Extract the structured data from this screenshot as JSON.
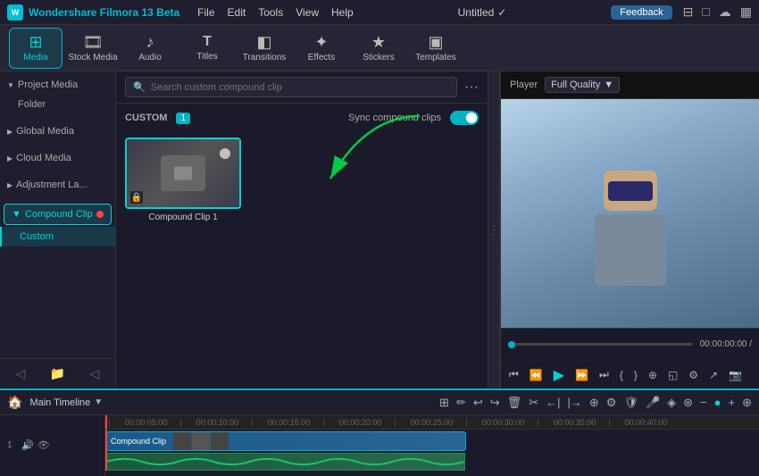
{
  "app": {
    "name": "Wondershare Filmora 13 Beta",
    "title": "Untitled",
    "feedback_label": "Feedback"
  },
  "topbar": {
    "menu": [
      "File",
      "Edit",
      "Tools",
      "View",
      "Help"
    ],
    "icons": [
      "⊟",
      "□",
      "⊞",
      "▦"
    ]
  },
  "toolbar": {
    "items": [
      {
        "id": "media",
        "icon": "⊞",
        "label": "Media",
        "active": true
      },
      {
        "id": "stock-media",
        "icon": "🎞",
        "label": "Stock Media",
        "active": false
      },
      {
        "id": "audio",
        "icon": "♪",
        "label": "Audio",
        "active": false
      },
      {
        "id": "titles",
        "icon": "T",
        "label": "Titles",
        "active": false
      },
      {
        "id": "transitions",
        "icon": "◧",
        "label": "Transitions",
        "active": false
      },
      {
        "id": "effects",
        "icon": "✦",
        "label": "Effects",
        "active": false
      },
      {
        "id": "stickers",
        "icon": "★",
        "label": "Stickers",
        "active": false
      },
      {
        "id": "templates",
        "icon": "▣",
        "label": "Templates",
        "active": false
      }
    ]
  },
  "sidebar": {
    "sections": [
      {
        "id": "project-media",
        "label": "Project Media",
        "expanded": true,
        "children": [
          "Folder"
        ]
      },
      {
        "id": "global-media",
        "label": "Global Media",
        "expanded": false,
        "children": []
      },
      {
        "id": "cloud-media",
        "label": "Cloud Media",
        "expanded": false,
        "children": []
      },
      {
        "id": "adjustment-la",
        "label": "Adjustment La...",
        "expanded": false,
        "children": []
      },
      {
        "id": "compound-clip",
        "label": "Compound Clip",
        "expanded": true,
        "active": true,
        "children": [
          "Custom"
        ]
      }
    ]
  },
  "content": {
    "search_placeholder": "Search custom compound clip",
    "custom_label": "CUSTOM",
    "custom_count": "1",
    "sync_label": "Sync compound clips",
    "sync_enabled": true,
    "clips": [
      {
        "id": "compound-clip-1",
        "label": "Compound Clip 1",
        "has_lock": true,
        "has_circle": true
      }
    ]
  },
  "preview": {
    "player_label": "Player",
    "quality_label": "Full Quality",
    "time_current": "00:00:00:00",
    "time_separator": "/",
    "controls": [
      "⏮",
      "⏪",
      "▶",
      "⏩",
      "⏭"
    ],
    "controls2": [
      "{ }",
      "| |",
      "⊕",
      "◱",
      "⊡",
      "⚙",
      "↗",
      "📷"
    ]
  },
  "timeline": {
    "label": "Main Timeline",
    "tracks": [
      {
        "id": "video-1",
        "type": "video",
        "num": "1",
        "clip_label": "Compound Clip",
        "clip_width_pct": 55
      }
    ],
    "ruler_marks": [
      "00:00:05:00",
      "00:00:10:00",
      "00:00:15:00",
      "00:00:20:00",
      "00:00:25:00",
      "00:00:30:00",
      "00:00:35:00",
      "00:00:40:00"
    ],
    "tools": [
      "⊞",
      "✏",
      "↩",
      "↪",
      "🗑",
      "✂",
      "←",
      "→",
      "⊕",
      "…",
      "⚙",
      "🛡",
      "🎤",
      "◈",
      "⊛",
      "⊞",
      "⊡",
      "−",
      "○",
      "○",
      "+",
      "⊕"
    ]
  },
  "colors": {
    "accent": "#00b4c4",
    "active_border": "#00d4d4",
    "danger": "#ff4444",
    "bg_dark": "#1a1a2e",
    "bg_panel": "#252535"
  }
}
